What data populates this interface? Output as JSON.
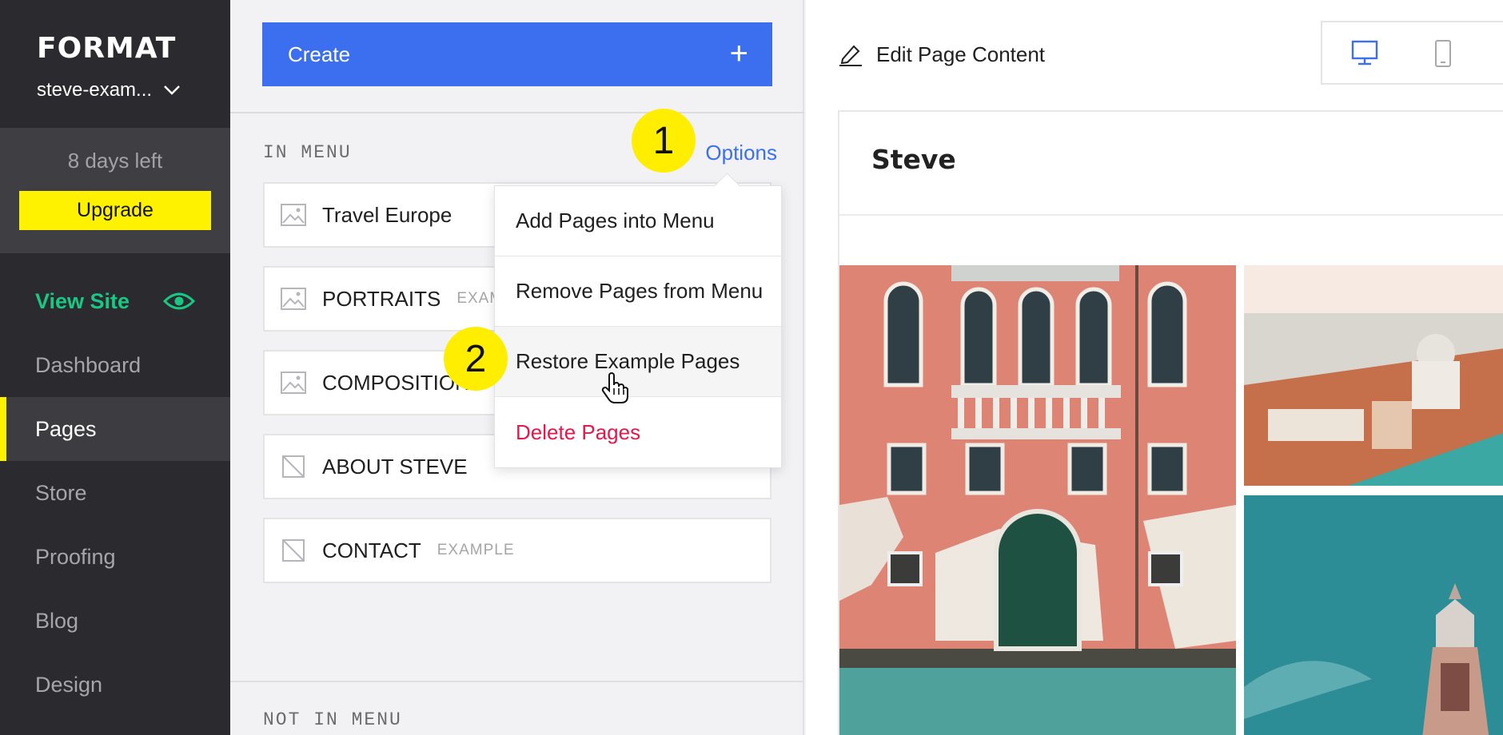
{
  "sidebar": {
    "logo": "FORMAT",
    "account": "steve-exam...",
    "trial_text": "8 days left",
    "upgrade_label": "Upgrade",
    "view_site": "View Site",
    "nav": [
      "Dashboard",
      "Pages",
      "Store",
      "Proofing",
      "Blog",
      "Design"
    ],
    "active": "Pages"
  },
  "pages_panel": {
    "create_label": "Create",
    "in_menu_label": "IN MENU",
    "options_label": "Options",
    "not_in_menu_label": "NOT IN MENU",
    "pages": [
      {
        "title": "Travel Europe",
        "tag": ""
      },
      {
        "title": "PORTRAITS",
        "tag": "EXAMPLE"
      },
      {
        "title": "COMPOSITIONS",
        "tag": ""
      },
      {
        "title": "ABOUT STEVE",
        "tag": ""
      },
      {
        "title": "CONTACT",
        "tag": "EXAMPLE"
      }
    ]
  },
  "options_menu": {
    "items": [
      "Add Pages into Menu",
      "Remove Pages from Menu",
      "Restore Example Pages",
      "Delete Pages"
    ]
  },
  "annotations": {
    "step1": "1",
    "step2": "2"
  },
  "preview": {
    "edit_label": "Edit Page Content",
    "site_name": "Steve"
  },
  "colors": {
    "accent": "#3b6ff0",
    "upgrade": "#fff200",
    "view_site": "#19c983",
    "danger": "#e8174a",
    "badge": "#ffee00"
  }
}
